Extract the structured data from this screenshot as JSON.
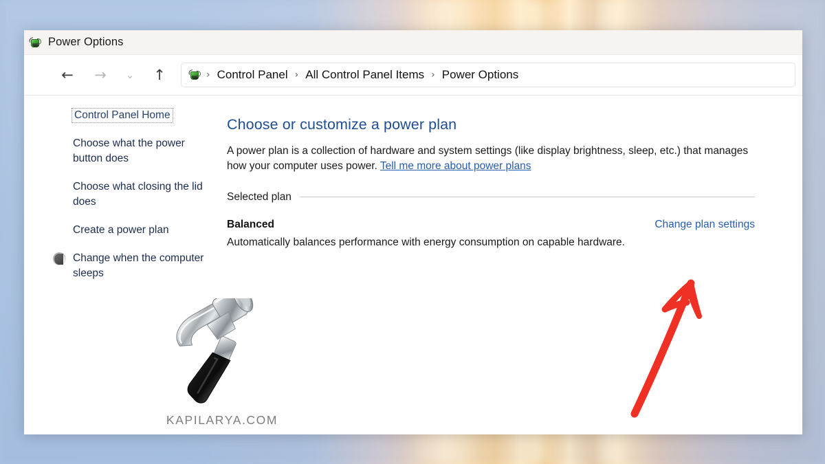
{
  "window": {
    "title": "Power Options",
    "title_icon": "control-panel-icon"
  },
  "nav": {
    "back": "←",
    "forward": "→",
    "recent": "⌄",
    "up": "↑",
    "breadcrumb": [
      {
        "label": "Control Panel"
      },
      {
        "label": "All Control Panel Items"
      },
      {
        "label": "Power Options"
      }
    ],
    "separator": "›"
  },
  "sidebar": {
    "home_label": "Control Panel Home",
    "items": [
      {
        "label": "Choose what the power button does",
        "icon": null
      },
      {
        "label": "Choose what closing the lid does",
        "icon": null
      },
      {
        "label": "Create a power plan",
        "icon": null
      },
      {
        "label": "Change when the computer sleeps",
        "icon": "moon-icon"
      }
    ]
  },
  "main": {
    "heading": "Choose or customize a power plan",
    "intro_text": "A power plan is a collection of hardware and system settings (like display brightness, sleep, etc.) that manages how your computer uses power. ",
    "intro_link": "Tell me more about power plans",
    "selected_plan_label": "Selected plan",
    "plan_name": "Balanced",
    "plan_change_link": "Change plan settings",
    "plan_description": "Automatically balances performance with energy consumption on capable hardware."
  },
  "watermark": {
    "text": "KAPILARYA.COM",
    "image": "hammer-icon"
  },
  "annotation": {
    "arrow": "red-arrow-pointing-up-right",
    "color": "#ee3124"
  },
  "colors": {
    "heading_blue": "#1f4e96",
    "link_blue": "#2a5db0",
    "window_bg": "#ffffff",
    "titlebar_bg": "#f6f3f1",
    "annotation_red": "#ee3124"
  }
}
